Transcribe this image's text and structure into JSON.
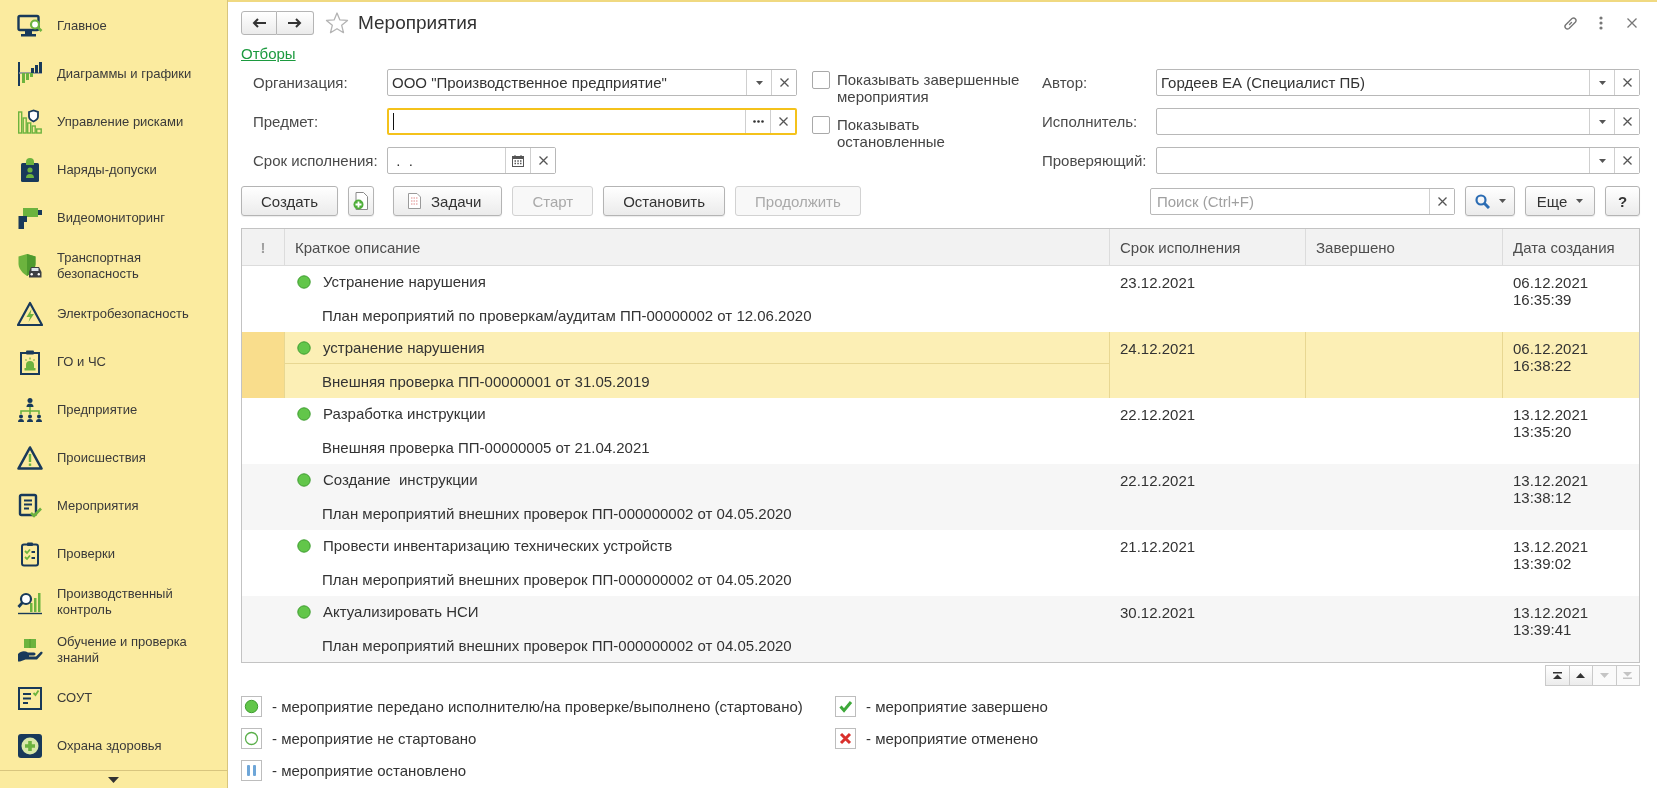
{
  "sidebar": {
    "items": [
      {
        "label": "Главное"
      },
      {
        "label": "Диаграммы и графики"
      },
      {
        "label": "Управление рисками"
      },
      {
        "label": "Наряды-допуски"
      },
      {
        "label": "Видеомониторинг"
      },
      {
        "label": "Транспортная безопасность"
      },
      {
        "label": "Электробезопасность"
      },
      {
        "label": "ГО и ЧС"
      },
      {
        "label": "Предприятие"
      },
      {
        "label": "Происшествия"
      },
      {
        "label": "Мероприятия"
      },
      {
        "label": "Проверки"
      },
      {
        "label": "Производственный контроль"
      },
      {
        "label": "Обучение и проверка знаний"
      },
      {
        "label": "СОУТ"
      },
      {
        "label": "Охрана здоровья"
      }
    ]
  },
  "window": {
    "title": "Мероприятия"
  },
  "filters": {
    "toggle_link": "Отборы",
    "left_fields": [
      {
        "label": "Организация:",
        "kind": "select",
        "value": "ООО \"Производственное предприятие\"",
        "focused": false
      },
      {
        "label": "Предмет:",
        "kind": "choice",
        "focused": true
      },
      {
        "label": "Срок исполнения:",
        "kind": "date",
        "value": " .  .",
        "focused": false
      }
    ],
    "checkboxes": [
      {
        "label": "Показывать завершенные мероприятия",
        "checked": false
      },
      {
        "label": "Показывать остановленные",
        "checked": false
      }
    ],
    "right_fields": [
      {
        "label": "Автор:",
        "kind": "select",
        "value": "Гордеев ЕА (Специалист ПБ)",
        "focused": false
      },
      {
        "label": "Исполнитель:",
        "kind": "select",
        "focused": false
      },
      {
        "label": "Проверяющий:",
        "kind": "select",
        "focused": false
      }
    ]
  },
  "toolbar": {
    "buttons": [
      {
        "kind": "text",
        "label": "Создать",
        "disabled": false
      },
      {
        "kind": "icon",
        "disabled": false
      },
      {
        "kind": "icon_text",
        "label": "Задачи",
        "disabled": false
      },
      {
        "kind": "text",
        "label": "Старт",
        "disabled": true
      },
      {
        "kind": "text",
        "label": "Остановить",
        "disabled": false
      },
      {
        "kind": "text",
        "label": "Продолжить",
        "disabled": true
      }
    ],
    "search": {
      "placeholder": "Поиск (Ctrl+F)"
    },
    "more_button": "Еще",
    "help_button": "?"
  },
  "table": {
    "columns": [
      "!",
      "Краткое описание",
      "Срок исполнения",
      "Завершено",
      "Дата создания"
    ],
    "rows": [
      {
        "kind": "started",
        "title": "Устранение нарушения",
        "basis": "План мероприятий по проверкам/аудитам ПП-00000002 от 12.06.2020",
        "due": "23.12.2021",
        "created_date": "06.12.2021",
        "created_time": "16:35:39",
        "selected": false
      },
      {
        "kind": "started",
        "title": "устранение нарушения",
        "basis": "Внешняя проверка ПП-00000001 от 31.05.2019",
        "due": "24.12.2021",
        "created_date": "06.12.2021",
        "created_time": "16:38:22",
        "selected": true
      },
      {
        "kind": "started",
        "title": "Разработка инструкции",
        "basis": "Внешняя проверка ПП-00000005 от 21.04.2021",
        "due": "22.12.2021",
        "created_date": "13.12.2021",
        "created_time": "13:35:20",
        "selected": false
      },
      {
        "kind": "started",
        "title": "Создание  инструкции",
        "basis": "План мероприятий внешних проверок ПП-000000002 от 04.05.2020",
        "due": "22.12.2021",
        "created_date": "13.12.2021",
        "created_time": "13:38:12",
        "selected": false
      },
      {
        "kind": "started",
        "title": "Провести инвентаризацию технических устройств",
        "basis": "План мероприятий внешних проверок ПП-000000002 от 04.05.2020",
        "due": "21.12.2021",
        "created_date": "13.12.2021",
        "created_time": "13:39:02",
        "selected": false
      },
      {
        "kind": "started",
        "title": "Актуализировать НСИ",
        "basis": "План мероприятий внешних проверок ПП-000000002 от 04.05.2020",
        "due": "30.12.2021",
        "created_date": "13.12.2021",
        "created_time": "13:39:41",
        "selected": false
      }
    ],
    "scroll_buttons": [
      {
        "kind": "first",
        "disabled": false
      },
      {
        "kind": "up",
        "disabled": false
      },
      {
        "kind": "down",
        "disabled": true
      },
      {
        "kind": "last",
        "disabled": true
      }
    ]
  },
  "legend": [
    {
      "kind": "started",
      "text": "- мероприятие передано исполнителю/на проверке/выполнено (стартовано)"
    },
    {
      "kind": "completed",
      "text": "- мероприятие завершено"
    },
    {
      "kind": "not_started",
      "text": "- мероприятие не стартовано"
    },
    {
      "kind": "cancelled",
      "text": "- мероприятие отменено"
    },
    {
      "kind": "stopped",
      "text": "- мероприятие остановлено"
    }
  ]
}
